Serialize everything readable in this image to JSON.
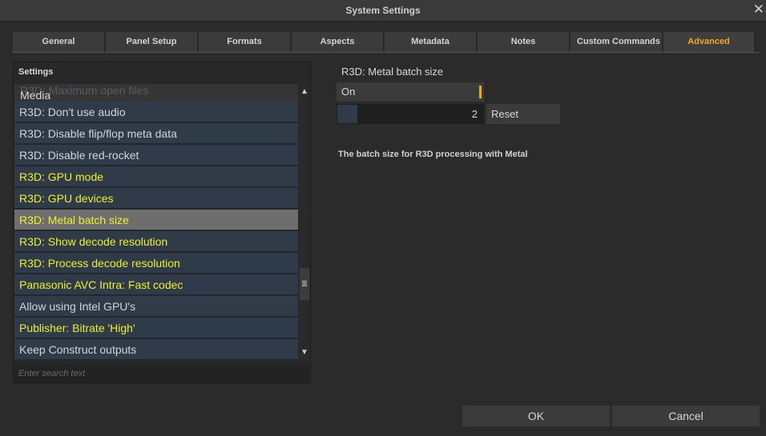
{
  "window": {
    "title": "System Settings",
    "close_glyph": "✕"
  },
  "tabs": [
    {
      "label": "General"
    },
    {
      "label": "Panel Setup"
    },
    {
      "label": "Formats"
    },
    {
      "label": "Aspects"
    },
    {
      "label": "Metadata"
    },
    {
      "label": "Notes"
    },
    {
      "label": "Custom Commands"
    },
    {
      "label": "Advanced",
      "active": true
    }
  ],
  "settings": {
    "header": "Settings",
    "ghost_item": "R3D: Maximum open files",
    "group_header": "Media",
    "items": [
      {
        "label": "R3D: Don't use audio",
        "color": "white"
      },
      {
        "label": "R3D: Disable flip/flop meta data",
        "color": "white"
      },
      {
        "label": "R3D: Disable red-rocket",
        "color": "white"
      },
      {
        "label": "R3D: GPU mode",
        "color": "yellow"
      },
      {
        "label": "R3D: GPU devices",
        "color": "yellow"
      },
      {
        "label": "R3D: Metal batch size",
        "color": "yellow",
        "selected": true
      },
      {
        "label": "R3D: Show decode resolution",
        "color": "yellow"
      },
      {
        "label": "R3D: Process decode resolution",
        "color": "yellow"
      },
      {
        "label": "Panasonic AVC Intra: Fast codec",
        "color": "yellow"
      },
      {
        "label": "Allow using Intel GPU's",
        "color": "white"
      },
      {
        "label": "Publisher: Bitrate 'High'",
        "color": "yellow"
      },
      {
        "label": "Keep Construct outputs",
        "color": "white"
      }
    ],
    "search_placeholder": "Enter search text",
    "scroll_up_glyph": "▲",
    "scroll_down_glyph": "▼"
  },
  "detail": {
    "title": "R3D: Metal batch size",
    "toggle_label": "On",
    "value": "2",
    "reset_label": "Reset",
    "description": "The batch size for R3D processing with Metal"
  },
  "footer": {
    "ok_label": "OK",
    "cancel_label": "Cancel"
  },
  "colors": {
    "accent": "#f5a623",
    "yellow_item": "#f0f028",
    "row_bg": "#2f3b49",
    "selected_bg": "#6e6e6e"
  }
}
